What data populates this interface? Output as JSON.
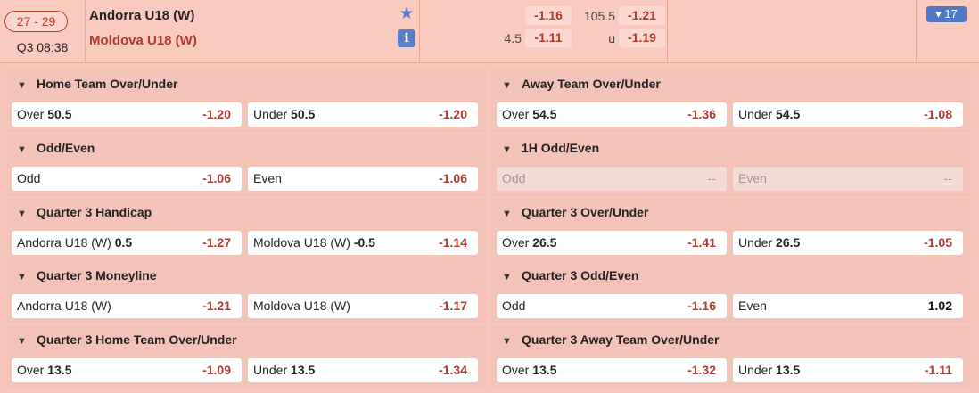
{
  "match": {
    "score": "27 - 29",
    "time": "Q3 08:38",
    "home_team": "Andorra U18 (W)",
    "away_team": "Moldova U18 (W)",
    "favorite_icon": "star-icon",
    "info_icon": "info-icon",
    "info_glyph": "i"
  },
  "header_odds": {
    "handicap_line": "4.5",
    "handicap_home": "-1.16",
    "handicap_away": "-1.11",
    "total_line": "105.5",
    "under_label": "u",
    "over": "-1.21",
    "under": "-1.19"
  },
  "more_markets": {
    "label": "▾ 17"
  },
  "colors": {
    "negative_odds": "#b03a2e",
    "accent_blue": "#4f77c4",
    "background": "#f7c7bc"
  },
  "markets": {
    "m0": {
      "title": "Home Team Over/Under",
      "a": {
        "label": "Over",
        "line": "50.5",
        "odds": "-1.20"
      },
      "b": {
        "label": "Under",
        "line": "50.5",
        "odds": "-1.20"
      }
    },
    "m1": {
      "title": "Away Team Over/Under",
      "a": {
        "label": "Over",
        "line": "54.5",
        "odds": "-1.36"
      },
      "b": {
        "label": "Under",
        "line": "54.5",
        "odds": "-1.08"
      }
    },
    "m2": {
      "title": "Odd/Even",
      "a": {
        "label": "Odd",
        "line": "",
        "odds": "-1.06"
      },
      "b": {
        "label": "Even",
        "line": "",
        "odds": "-1.06"
      }
    },
    "m3": {
      "title": "1H Odd/Even",
      "a": {
        "label": "Odd",
        "line": "",
        "odds": "--"
      },
      "b": {
        "label": "Even",
        "line": "",
        "odds": "--"
      }
    },
    "m4": {
      "title": "Quarter 3 Handicap",
      "a": {
        "label": "Andorra U18 (W)",
        "line": "0.5",
        "odds": "-1.27"
      },
      "b": {
        "label": "Moldova U18 (W)",
        "line": "-0.5",
        "odds": "-1.14"
      }
    },
    "m5": {
      "title": "Quarter 3 Over/Under",
      "a": {
        "label": "Over",
        "line": "26.5",
        "odds": "-1.41"
      },
      "b": {
        "label": "Under",
        "line": "26.5",
        "odds": "-1.05"
      }
    },
    "m6": {
      "title": "Quarter 3 Moneyline",
      "a": {
        "label": "Andorra U18 (W)",
        "line": "",
        "odds": "-1.21"
      },
      "b": {
        "label": "Moldova U18 (W)",
        "line": "",
        "odds": "-1.17"
      }
    },
    "m7": {
      "title": "Quarter 3 Odd/Even",
      "a": {
        "label": "Odd",
        "line": "",
        "odds": "-1.16"
      },
      "b": {
        "label": "Even",
        "line": "",
        "odds": "1.02"
      }
    },
    "m8": {
      "title": "Quarter 3 Home Team Over/Under",
      "a": {
        "label": "Over",
        "line": "13.5",
        "odds": "-1.09"
      },
      "b": {
        "label": "Under",
        "line": "13.5",
        "odds": "-1.34"
      }
    },
    "m9": {
      "title": "Quarter 3 Away Team Over/Under",
      "a": {
        "label": "Over",
        "line": "13.5",
        "odds": "-1.32"
      },
      "b": {
        "label": "Under",
        "line": "13.5",
        "odds": "-1.11"
      }
    }
  }
}
